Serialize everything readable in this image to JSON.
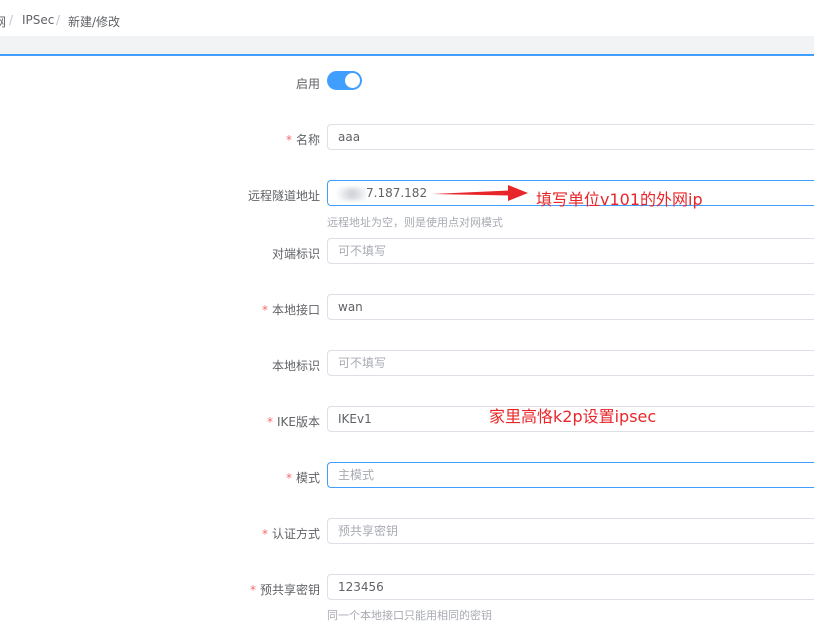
{
  "breadcrumb": {
    "items": [
      "网",
      "IPSec",
      "新建/修改"
    ],
    "separator": "/"
  },
  "form": {
    "enable_label": "启用",
    "enable_state": true,
    "name": {
      "label": "名称",
      "value": "aaa"
    },
    "remote_address": {
      "label": "远程隧道地址",
      "value": "7.187.182",
      "hint": "远程地址为空，则是使用点对网模式"
    },
    "peer_id": {
      "label": "对端标识",
      "placeholder": "可不填写"
    },
    "local_interface": {
      "label": "本地接口",
      "value": "wan"
    },
    "local_id": {
      "label": "本地标识",
      "placeholder": "可不填写"
    },
    "ike_version": {
      "label": "IKE版本",
      "value": "IKEv1"
    },
    "mode": {
      "label": "模式",
      "placeholder": "主模式"
    },
    "auth_method": {
      "label": "认证方式",
      "placeholder": "预共享密钥"
    },
    "psk": {
      "label": "预共享密钥",
      "value": "123456",
      "hint": "同一个本地接口只能用相同的密钥"
    }
  },
  "annotations": {
    "arrow_note": "填写单位v101的外网ip",
    "router_note": "家里高恪k2p设置ipsec",
    "color": "#e8262a"
  },
  "colors": {
    "accent": "#409eff",
    "required": "#f56c6c"
  }
}
